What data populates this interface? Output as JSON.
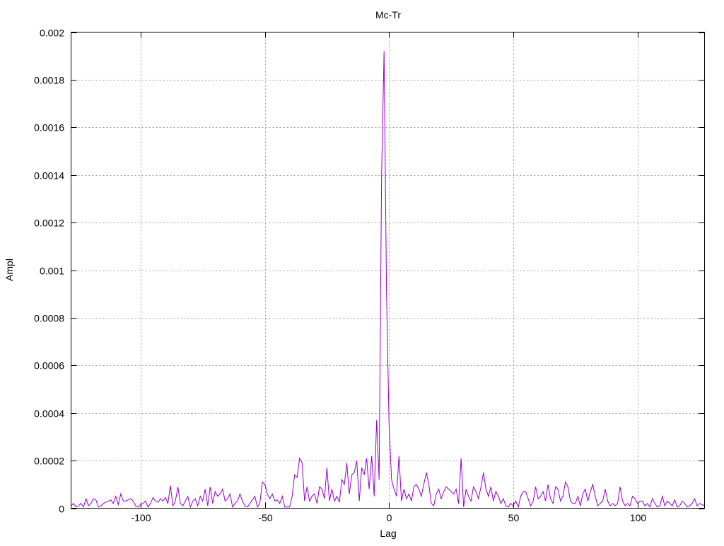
{
  "chart_data": {
    "type": "line",
    "title": "Mc-Tr",
    "xlabel": "Lag",
    "ylabel": "Ampl",
    "xlim": [
      -128,
      127
    ],
    "ylim": [
      0,
      0.002
    ],
    "grid": true,
    "legend": "none",
    "line_color": "#9400D3",
    "x_ticks": [
      -100,
      -50,
      0,
      50,
      100
    ],
    "x_tick_labels": [
      "-100",
      "-50",
      "0",
      "50",
      "100"
    ],
    "y_ticks": [
      0,
      0.0002,
      0.0004,
      0.0006,
      0.0008,
      0.001,
      0.0012,
      0.0014,
      0.0016,
      0.0018,
      0.002
    ],
    "y_tick_labels": [
      "0",
      "0.0002",
      "0.0004",
      "0.0006",
      "0.0008",
      "0.001",
      "0.0012",
      "0.0014",
      "0.0016",
      "0.0018",
      "0.002"
    ],
    "x_start": -128,
    "x_step": 1,
    "values": [
      1e-05,
      2e-05,
      5e-06,
      1e-05,
      2e-05,
      5e-06,
      4e-05,
      1e-05,
      2e-05,
      4e-05,
      3.5e-05,
      5e-06,
      1e-05,
      2e-05,
      2.5e-05,
      3e-05,
      3.5e-05,
      2e-05,
      5e-05,
      1.5e-05,
      6e-05,
      3e-05,
      3e-05,
      3.5e-05,
      4e-05,
      3e-05,
      1e-05,
      5e-06,
      1.5e-05,
      2e-05,
      3e-05,
      5e-06,
      2e-05,
      4.5e-05,
      3e-05,
      2.5e-05,
      4e-05,
      3e-05,
      4.5e-05,
      2e-05,
      9.5e-05,
      1e-05,
      3e-05,
      9e-05,
      2e-05,
      1e-05,
      3e-05,
      5e-05,
      5e-06,
      3e-05,
      4e-05,
      1e-05,
      5e-05,
      3e-05,
      8e-05,
      1e-05,
      9e-05,
      2e-05,
      7e-05,
      5e-05,
      6e-05,
      8e-05,
      3e-05,
      4e-05,
      6e-05,
      5e-06,
      2e-05,
      3e-05,
      6e-05,
      3e-05,
      1e-05,
      5e-06,
      2e-05,
      3.5e-05,
      5e-05,
      5e-06,
      2e-05,
      0.00011,
      0.0001,
      6e-05,
      4e-05,
      6e-05,
      3e-05,
      3.5e-05,
      2e-05,
      5e-05,
      5e-06,
      5e-06,
      5e-06,
      5e-05,
      0.00014,
      0.00013,
      0.00021,
      0.00019,
      3e-05,
      9e-05,
      3e-05,
      5e-05,
      6e-05,
      2e-05,
      9e-05,
      8e-05,
      4e-05,
      0.00017,
      3e-05,
      8e-05,
      3e-05,
      5e-05,
      2.5e-05,
      0.00012,
      0.0001,
      0.00019,
      6e-05,
      0.00014,
      0.00015,
      0.0002,
      3e-05,
      0.00017,
      0.00014,
      0.00021,
      8e-05,
      0.00022,
      5e-05,
      0.00037,
      0.00012,
      0.0014,
      0.00192,
      0.0009,
      0.00035,
      0.00012,
      8e-05,
      5e-05,
      0.00022,
      3e-05,
      8e-05,
      4e-05,
      6e-05,
      3e-05,
      9e-05,
      0.0001,
      8e-05,
      5e-05,
      0.0001,
      0.00015,
      0.0001,
      2e-05,
      1e-05,
      6e-05,
      8e-05,
      4e-05,
      7e-05,
      9e-05,
      8e-05,
      7e-05,
      6e-05,
      8e-05,
      2e-05,
      0.00021,
      5e-06,
      8e-05,
      5e-05,
      3e-05,
      9e-05,
      7e-05,
      4e-05,
      9e-05,
      0.00015,
      8e-05,
      5e-05,
      9e-05,
      3e-05,
      7e-05,
      5e-05,
      2e-05,
      4e-05,
      1e-05,
      5e-06,
      2e-05,
      1e-05,
      3e-05,
      5e-06,
      5e-05,
      7e-05,
      7e-05,
      4e-05,
      1e-05,
      3e-05,
      9e-05,
      4e-05,
      5e-05,
      7e-05,
      3e-05,
      0.0001,
      4e-05,
      2e-05,
      9e-05,
      8e-05,
      3e-05,
      5e-05,
      0.00011,
      9e-05,
      3e-05,
      2e-05,
      2e-05,
      5e-05,
      1e-05,
      6e-05,
      8e-05,
      3e-05,
      7e-05,
      0.0001,
      5e-05,
      1e-05,
      2e-05,
      3e-05,
      8e-05,
      3e-05,
      1e-05,
      2e-05,
      1e-05,
      2e-05,
      9e-05,
      3e-05,
      1e-05,
      2e-05,
      1e-05,
      5e-05,
      4e-05,
      2e-05,
      3e-05,
      3e-05,
      1e-05,
      2e-05,
      5e-06,
      4e-05,
      2e-05,
      5e-06,
      1e-05,
      5e-05,
      1e-05,
      3e-05,
      2e-05,
      1e-05,
      3.5e-05,
      5e-06,
      1e-05,
      3e-05,
      2e-05,
      5e-06,
      1e-05,
      2e-05,
      4e-05,
      1e-05,
      2e-05,
      1.5e-05,
      1e-05
    ]
  }
}
